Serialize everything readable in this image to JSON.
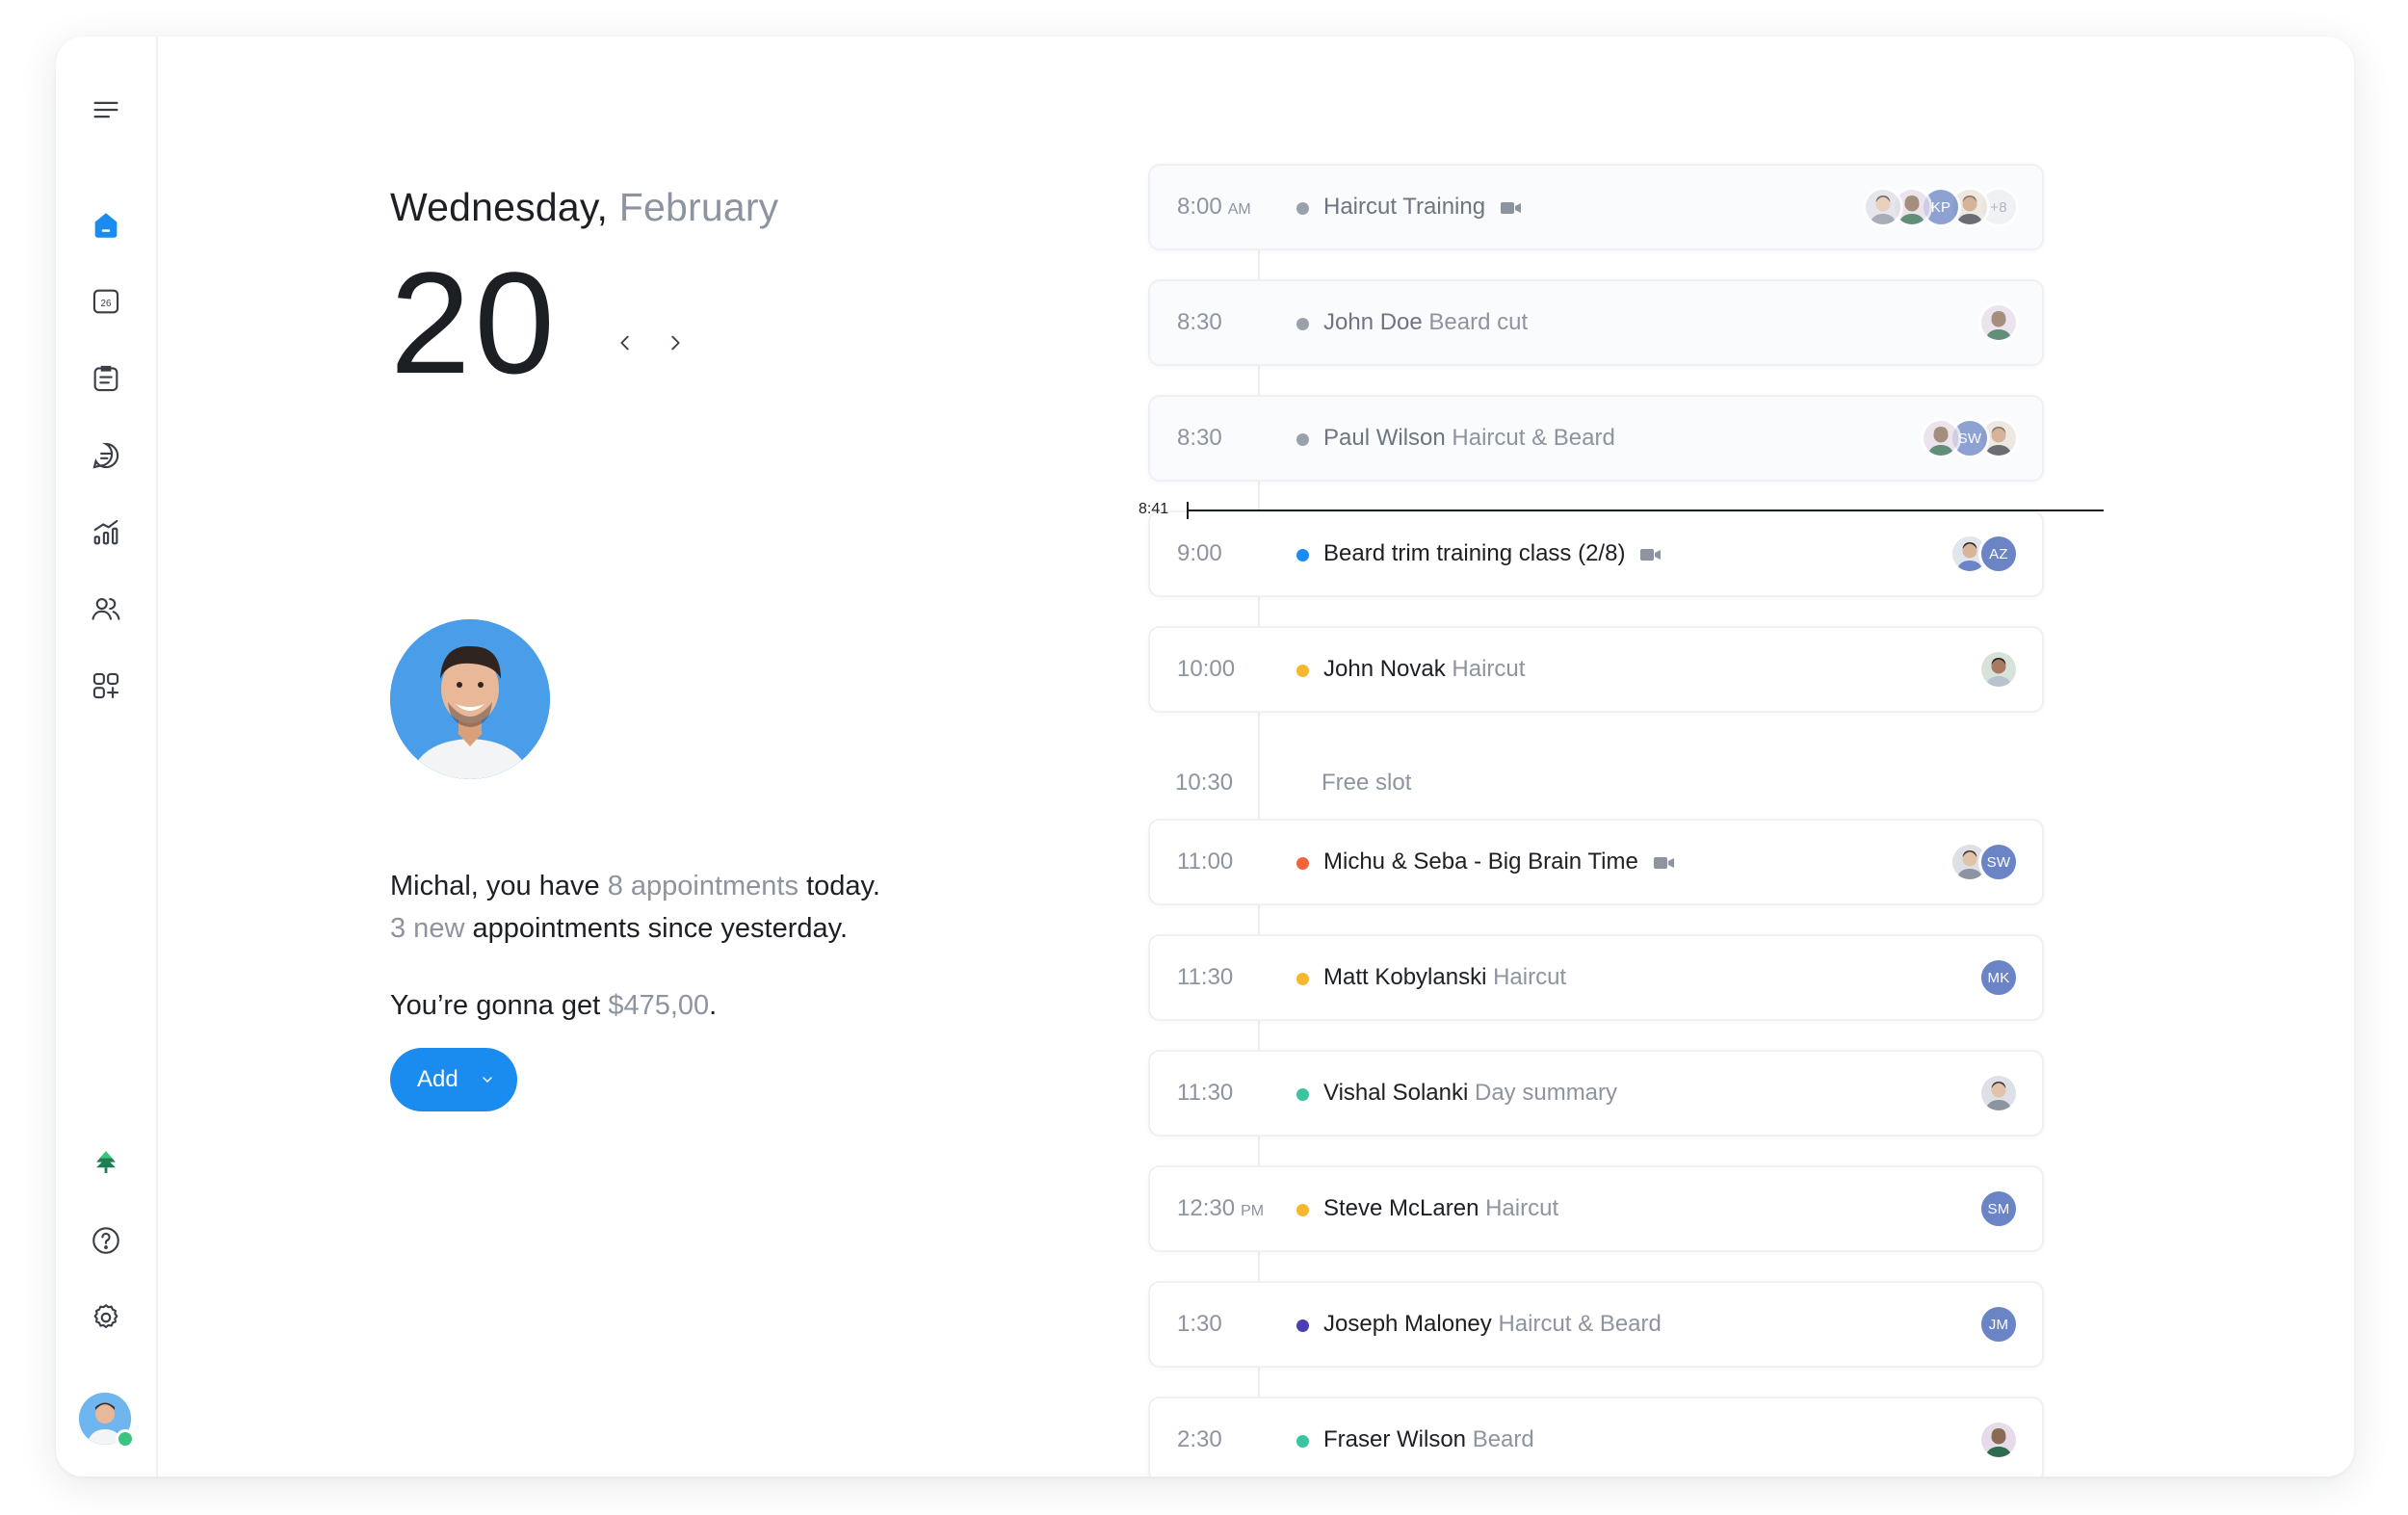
{
  "sidebar": {
    "items": [
      {
        "icon": "menu-icon"
      },
      {
        "icon": "home-icon",
        "active": true
      },
      {
        "icon": "calendar-icon",
        "badge": "26"
      },
      {
        "icon": "clipboard-icon"
      },
      {
        "icon": "chat-icon"
      },
      {
        "icon": "analytics-icon"
      },
      {
        "icon": "users-icon"
      },
      {
        "icon": "apps-icon"
      }
    ],
    "bottom": [
      {
        "icon": "tree-logo-icon"
      },
      {
        "icon": "help-icon"
      },
      {
        "icon": "settings-icon"
      },
      {
        "icon": "user-avatar",
        "status": "online"
      }
    ]
  },
  "date": {
    "weekday": "Wednesday,",
    "month": "February",
    "day": "20"
  },
  "summary": {
    "line1_prefix": "Michal, you have",
    "line1_count": "8 appointments",
    "line1_suffix": "today.",
    "line2_count": "3 new",
    "line2_suffix": "appointments since yesterday.",
    "earn_prefix": "You’re gonna get",
    "earn_amount": "$475,00",
    "earn_suffix": "."
  },
  "add_button": {
    "label": "Add"
  },
  "now_marker": {
    "label": "8:41"
  },
  "appointments": [
    {
      "time": "8:00",
      "ampm": "AM",
      "name": "Haircut Training",
      "service": "",
      "dot": "#9aa1ab",
      "video": true,
      "past": true,
      "avatars": [
        {
          "type": "photo"
        },
        {
          "type": "photo"
        },
        {
          "type": "initials",
          "text": "KP"
        },
        {
          "type": "photo"
        },
        {
          "type": "more",
          "text": "+8"
        }
      ]
    },
    {
      "time": "8:30",
      "ampm": "",
      "name": "John Doe",
      "service": "Beard cut",
      "dot": "#9aa1ab",
      "video": false,
      "past": true,
      "avatars": [
        {
          "type": "photo"
        }
      ]
    },
    {
      "time": "8:30",
      "ampm": "",
      "name": "Paul Wilson",
      "service": "Haircut & Beard",
      "dot": "#9aa1ab",
      "video": false,
      "past": true,
      "avatars": [
        {
          "type": "photo"
        },
        {
          "type": "initials",
          "text": "SW"
        },
        {
          "type": "photo"
        }
      ]
    },
    {
      "time": "9:00",
      "ampm": "",
      "name": "Beard trim training class (2/8)",
      "service": "",
      "dot": "#1a8cf0",
      "video": true,
      "past": false,
      "avatars": [
        {
          "type": "photo"
        },
        {
          "type": "initials",
          "text": "AZ"
        }
      ]
    },
    {
      "time": "10:00",
      "ampm": "",
      "name": "John Novak",
      "service": "Haircut",
      "dot": "#f5b731",
      "video": false,
      "past": false,
      "avatars": [
        {
          "type": "photo"
        }
      ]
    },
    {
      "time": "10:30",
      "ampm": "",
      "name": "",
      "service": "Free slot",
      "dot": "",
      "video": false,
      "past": false,
      "free": true,
      "avatars": []
    },
    {
      "time": "11:00",
      "ampm": "",
      "name": "Michu & Seba - Big Brain Time",
      "service": "",
      "dot": "#f2643a",
      "video": true,
      "past": false,
      "avatars": [
        {
          "type": "photo"
        },
        {
          "type": "initials",
          "text": "SW"
        }
      ]
    },
    {
      "time": "11:30",
      "ampm": "",
      "name": "Matt Kobylanski",
      "service": "Haircut",
      "dot": "#f5b731",
      "video": false,
      "past": false,
      "avatars": [
        {
          "type": "initials",
          "text": "MK"
        }
      ]
    },
    {
      "time": "11:30",
      "ampm": "",
      "name": "Vishal Solanki",
      "service": "Day summary",
      "dot": "#3ac4a0",
      "video": false,
      "past": false,
      "avatars": [
        {
          "type": "photo"
        }
      ]
    },
    {
      "time": "12:30",
      "ampm": "PM",
      "name": "Steve McLaren",
      "service": "Haircut",
      "dot": "#f5b731",
      "video": false,
      "past": false,
      "avatars": [
        {
          "type": "initials",
          "text": "SM"
        }
      ]
    },
    {
      "time": "1:30",
      "ampm": "",
      "name": "Joseph Maloney",
      "service": "Haircut & Beard",
      "dot": "#4b3fb0",
      "video": false,
      "past": false,
      "avatars": [
        {
          "type": "initials",
          "text": "JM"
        }
      ]
    },
    {
      "time": "2:30",
      "ampm": "",
      "name": "Fraser Wilson",
      "service": "Beard",
      "dot": "#3ac4a0",
      "video": false,
      "past": false,
      "avatars": [
        {
          "type": "photo"
        }
      ]
    }
  ]
}
